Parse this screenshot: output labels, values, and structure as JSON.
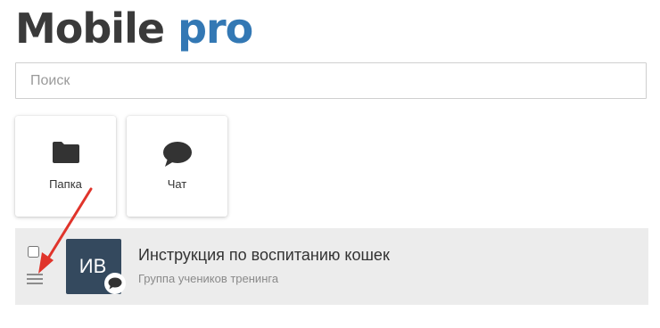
{
  "app": {
    "title_main": "Mobile",
    "title_accent": "pro"
  },
  "search": {
    "placeholder": "Поиск",
    "value": ""
  },
  "tiles": [
    {
      "label": "Папка",
      "icon": "folder-icon"
    },
    {
      "label": "Чат",
      "icon": "chat-bubble-icon"
    }
  ],
  "list": {
    "items": [
      {
        "checked": false,
        "avatar_initials": "ИВ",
        "avatar_color": "#34495e",
        "badge_icon": "chat-bubble-icon",
        "title": "Инструкция по воспитанию кошек",
        "subtitle": "Группа учеников тренинга"
      }
    ]
  },
  "annotation": {
    "arrow_color": "#e0342b",
    "points_to": "drag-handle"
  },
  "colors": {
    "title_dark": "#3a3a3a",
    "title_accent": "#3378b4",
    "row_background": "#ececec",
    "icon_dark": "#333333"
  }
}
